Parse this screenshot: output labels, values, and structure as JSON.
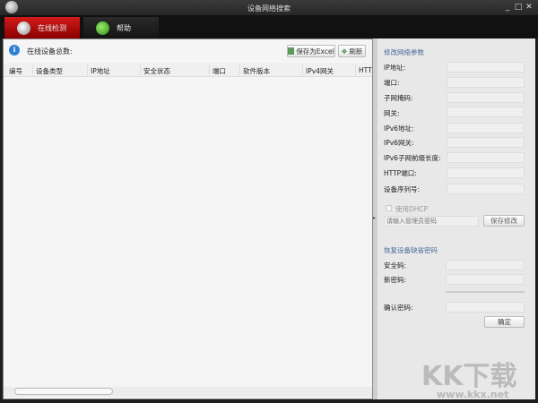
{
  "window": {
    "title": "设备网络搜索",
    "minimize": "_",
    "maximize": "□",
    "close": "✕"
  },
  "tabs": [
    {
      "label": "在线检测",
      "active": true
    },
    {
      "label": "帮助",
      "active": false
    }
  ],
  "toolbar": {
    "count_label": "在线设备总数:",
    "save_excel": "保存为Excel",
    "refresh": "刷新"
  },
  "table": {
    "columns": [
      "编号",
      "设备类型",
      "IP地址",
      "安全状态",
      "端口",
      "软件版本",
      "IPv4网关",
      "HTT"
    ],
    "rows": []
  },
  "modify": {
    "title": "修改网络参数",
    "fields": [
      "IP地址:",
      "端口:",
      "子网掩码:",
      "网关:",
      "IPv6地址:",
      "IPv6网关:",
      "IPv6子网前缀长度:",
      "HTTP端口:",
      "设备序列号:"
    ],
    "dhcp_label": "使用DHCP",
    "admin_placeholder": "请输入管理员密码",
    "save_button": "保存修改"
  },
  "restore": {
    "title": "恢复设备缺省密码",
    "security_code": "安全码:",
    "new_password": "新密码:",
    "confirm_password": "确认密码:",
    "ok_button": "确定"
  },
  "watermark": {
    "logo": "KK下载",
    "url": "www.kkx.net"
  }
}
